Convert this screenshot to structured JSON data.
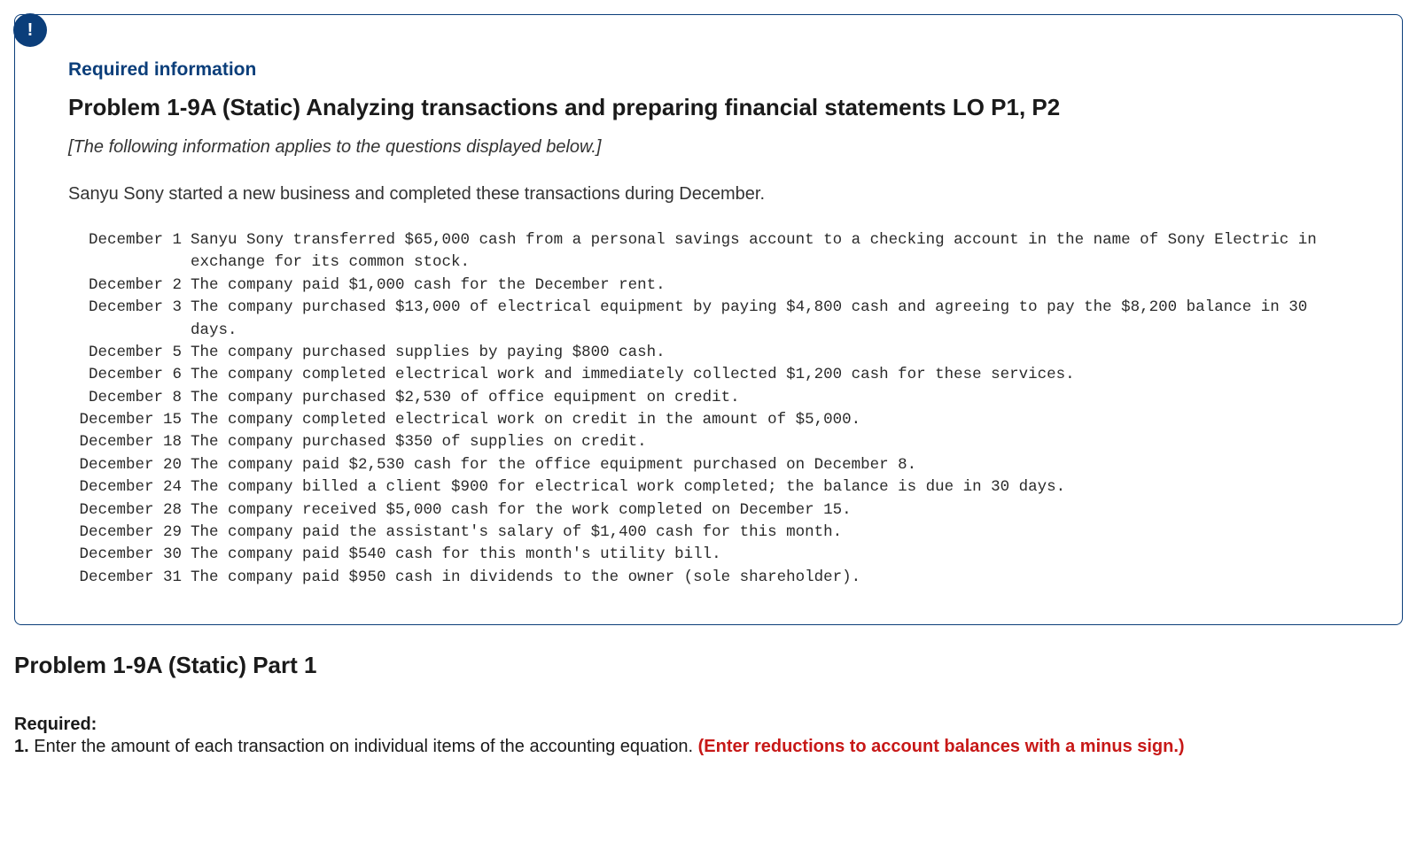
{
  "info": {
    "badge": "!",
    "required_label": "Required information",
    "problem_title": "Problem 1-9A (Static) Analyzing transactions and preparing financial statements LO P1, P2",
    "note": "[The following information applies to the questions displayed below.]",
    "lead": "Sanyu Sony started a new business and completed these transactions during December.",
    "transactions": [
      {
        "date": "December 1",
        "desc": "Sanyu Sony transferred $65,000 cash from a personal savings account to a checking account in the name of Sony Electric in exchange for its common stock."
      },
      {
        "date": "December 2",
        "desc": "The company paid $1,000 cash for the December rent."
      },
      {
        "date": "December 3",
        "desc": "The company purchased $13,000 of electrical equipment by paying $4,800 cash and agreeing to pay the $8,200 balance in 30 days."
      },
      {
        "date": "December 5",
        "desc": "The company purchased supplies by paying $800 cash."
      },
      {
        "date": "December 6",
        "desc": "The company completed electrical work and immediately collected $1,200 cash for these services."
      },
      {
        "date": "December 8",
        "desc": "The company purchased $2,530 of office equipment on credit."
      },
      {
        "date": "December 15",
        "desc": "The company completed electrical work on credit in the amount of $5,000."
      },
      {
        "date": "December 18",
        "desc": "The company purchased $350 of supplies on credit."
      },
      {
        "date": "December 20",
        "desc": "The company paid $2,530 cash for the office equipment purchased on December 8."
      },
      {
        "date": "December 24",
        "desc": "The company billed a client $900 for electrical work completed; the balance is due in 30 days."
      },
      {
        "date": "December 28",
        "desc": "The company received $5,000 cash for the work completed on December 15."
      },
      {
        "date": "December 29",
        "desc": "The company paid the assistant's salary of $1,400 cash for this month."
      },
      {
        "date": "December 30",
        "desc": "The company paid $540 cash for this month's utility bill."
      },
      {
        "date": "December 31",
        "desc": "The company paid $950 cash in dividends to the owner (sole shareholder)."
      }
    ]
  },
  "part": {
    "title": "Problem 1-9A (Static) Part 1",
    "required_label": "Required:",
    "item_number": "1.",
    "item_text": " Enter the amount of each transaction on individual items of the accounting equation. ",
    "item_emph": "(Enter reductions to account balances with a minus sign.)"
  }
}
